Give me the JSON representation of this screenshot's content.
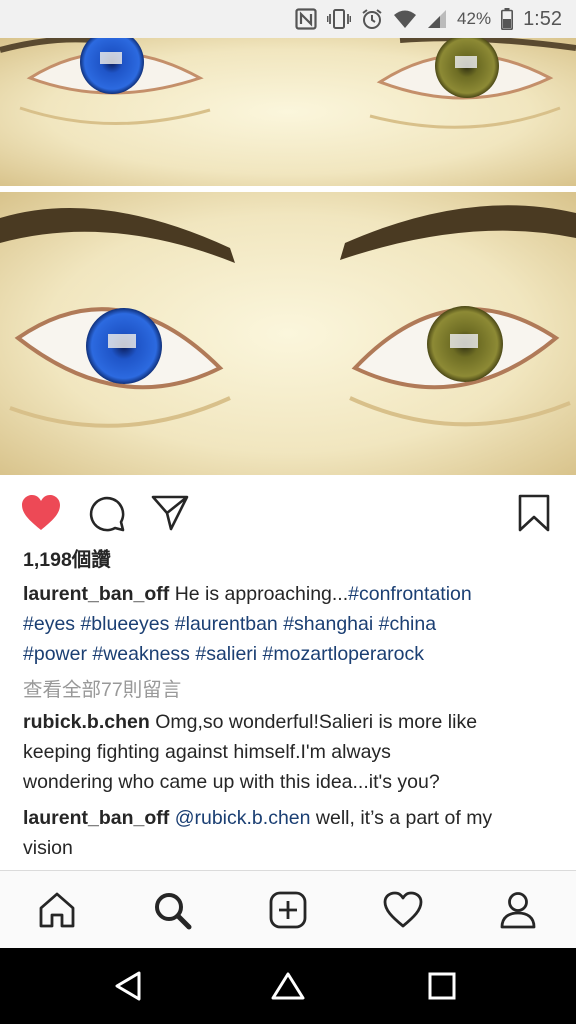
{
  "status_bar": {
    "icons": [
      "nfc-icon",
      "vibrate-icon",
      "alarm-icon",
      "wifi-icon",
      "signal-icon",
      "battery-icon"
    ],
    "battery_percent": "42%",
    "time": "1:52"
  },
  "post": {
    "image": {
      "subject": "eyes-photo",
      "colors": {
        "blue_iris": "#1f55c8",
        "green_iris": "#7a7a28",
        "skin": "#f1e6bf"
      }
    },
    "actions": {
      "like_icon": "heart-icon",
      "comment_icon": "comment-icon",
      "share_icon": "direct-share-icon",
      "save_icon": "bookmark-icon",
      "liked": true
    },
    "likes": "1,198個讚",
    "caption": {
      "username": "laurent_ban_off",
      "text": "He is approaching...",
      "hashtags_line1": "#confrontation",
      "hashtags_line2": "#eyes #blueeyes #laurentban #shanghai #china",
      "hashtags_line3": "#power #weakness #salieri #mozartloperarock"
    },
    "view_all_comments": "查看全部77則留言",
    "comments": [
      {
        "username": "rubick.b.chen",
        "line1": "Omg,so wonderful!Salieri is more like",
        "line2": "keeping fighting against himself.I'm always",
        "line3": "wondering who came up with this idea...it's you?"
      },
      {
        "username": "laurent_ban_off",
        "mention": "@rubick.b.chen",
        "line1": "well, it’s a part of my",
        "line2": "vision"
      }
    ]
  },
  "bottom_nav": [
    "home-icon",
    "search-icon",
    "add-post-icon",
    "activity-icon",
    "profile-icon"
  ],
  "android_nav": [
    "back-icon",
    "home-icon",
    "recents-icon"
  ],
  "colors": {
    "like_red": "#ed4956",
    "link_blue": "#1b3f73",
    "muted_gray": "#999999"
  }
}
